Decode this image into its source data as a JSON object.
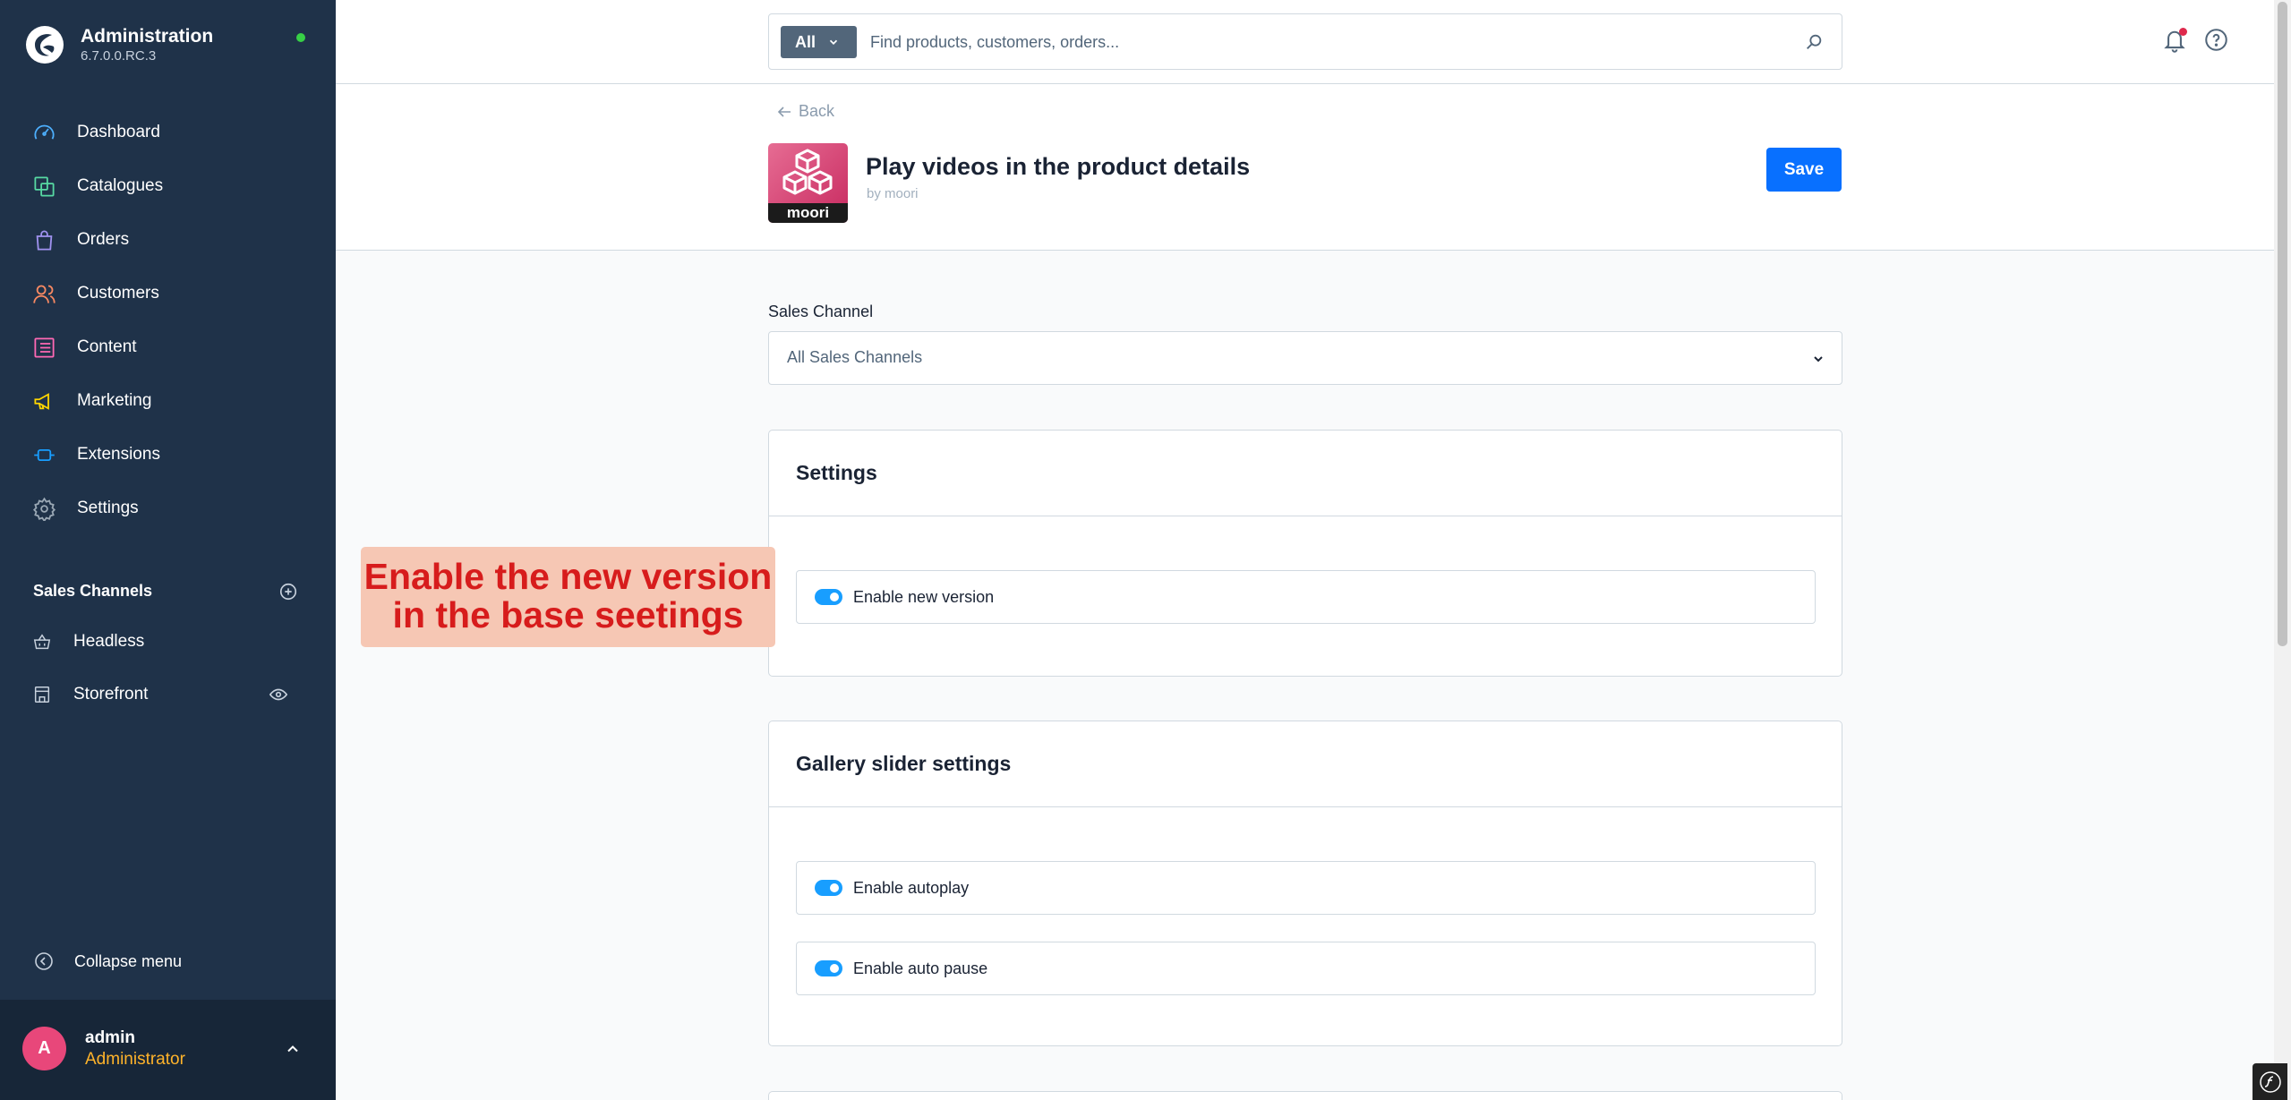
{
  "sidebar": {
    "brand_title": "Administration",
    "brand_version": "6.7.0.0.RC.3",
    "nav": [
      {
        "label": "Dashboard",
        "icon": "dashboard-icon",
        "color": "#4db0ff"
      },
      {
        "label": "Catalogues",
        "icon": "catalogues-icon",
        "color": "#57d9a3"
      },
      {
        "label": "Orders",
        "icon": "orders-icon",
        "color": "#a092f0"
      },
      {
        "label": "Customers",
        "icon": "customers-icon",
        "color": "#f88962"
      },
      {
        "label": "Content",
        "icon": "content-icon",
        "color": "#ff68b4"
      },
      {
        "label": "Marketing",
        "icon": "marketing-icon",
        "color": "#ffd700"
      },
      {
        "label": "Extensions",
        "icon": "extensions-icon",
        "color": "#189eff"
      },
      {
        "label": "Settings",
        "icon": "settings-icon",
        "color": "#9aa8b5"
      }
    ],
    "sales_channels_header": "Sales Channels",
    "sales_channels": [
      {
        "label": "Headless",
        "icon": "basket-icon"
      },
      {
        "label": "Storefront",
        "icon": "storefront-icon"
      }
    ],
    "collapse_label": "Collapse menu",
    "user": {
      "initial": "A",
      "name": "admin",
      "role": "Administrator"
    }
  },
  "topbar": {
    "search_type": "All",
    "search_placeholder": "Find products, customers, orders..."
  },
  "header": {
    "back_label": "Back",
    "app_icon_label": "moori",
    "title": "Play videos in the product details",
    "by": "by moori",
    "save_label": "Save"
  },
  "content": {
    "sales_channel_label": "Sales Channel",
    "sales_channel_value": "All Sales Channels",
    "settings_card": {
      "title": "Settings",
      "switches": [
        {
          "label": "Enable new version",
          "checked": true
        }
      ]
    },
    "gallery_card": {
      "title": "Gallery slider settings",
      "switches": [
        {
          "label": "Enable autoplay",
          "checked": true
        },
        {
          "label": "Enable auto pause",
          "checked": true
        }
      ]
    }
  },
  "callout": {
    "line1": "Enable the new version",
    "line2": "in the base seetings"
  },
  "colors": {
    "sidebar_bg": "#1f3249",
    "primary": "#0870ff",
    "toggle_on": "#189eff",
    "callout_bg": "#f6c7b4",
    "callout_text": "#d71c1c"
  }
}
